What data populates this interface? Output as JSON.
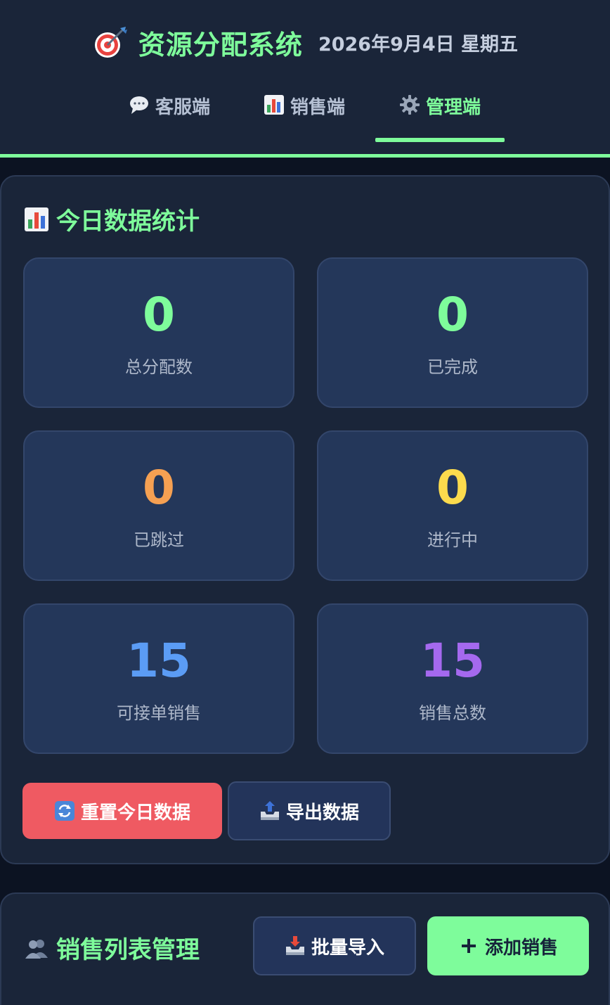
{
  "app": {
    "title": "资源分配系统",
    "date": "2026年9月4日 星期五",
    "icon": "dart-target-icon"
  },
  "tabs": [
    {
      "label": "客服端",
      "icon": "speech-bubble-icon",
      "active": false
    },
    {
      "label": "销售端",
      "icon": "bar-chart-icon",
      "active": false
    },
    {
      "label": "管理端",
      "icon": "gear-icon",
      "active": true
    }
  ],
  "stats": {
    "title": "今日数据统计",
    "icon": "bar-chart-icon",
    "items": [
      {
        "value": "0",
        "label": "总分配数",
        "color": "#7efc9b"
      },
      {
        "value": "0",
        "label": "已完成",
        "color": "#7efc9b"
      },
      {
        "value": "0",
        "label": "已跳过",
        "color": "#f5a052"
      },
      {
        "value": "0",
        "label": "进行中",
        "color": "#fcdb4d"
      },
      {
        "value": "15",
        "label": "可接单销售",
        "color": "#5b9cf5"
      },
      {
        "value": "15",
        "label": "销售总数",
        "color": "#a569ef"
      }
    ],
    "reset_label": "重置今日数据",
    "export_label": "导出数据"
  },
  "sales": {
    "title": "销售列表管理",
    "icon": "people-icon",
    "import_label": "批量导入",
    "add_label": "添加销售"
  },
  "colors": {
    "accent": "#7efc9b",
    "danger": "#ef5a62",
    "background": "#1a2539"
  }
}
